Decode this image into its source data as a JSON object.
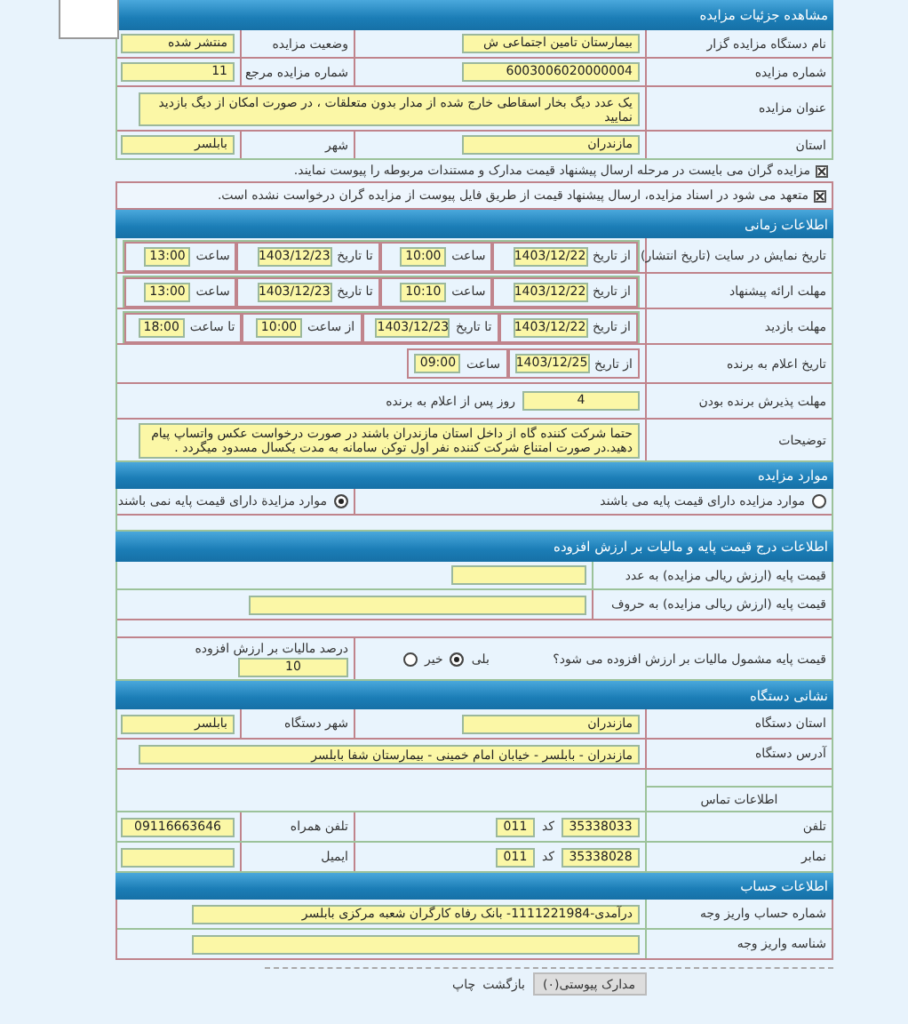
{
  "header": "مشاهده جزئیات مزایده",
  "general": [
    {
      "kind": "pair",
      "label": "نام دستگاه مزایده گزار",
      "value": "بیمارستان تامین اجتماعی ش",
      "side_label": "وضعیت مزایده",
      "side_value": "منتشر شده"
    },
    {
      "kind": "pair",
      "label": "شماره مزایده",
      "value": "6003006020000004",
      "side_label": "شماره مزایده مرجع",
      "side_value": "11"
    },
    {
      "kind": "wide",
      "label": "عنوان مزایده",
      "value": "یک عدد دیگ بخار اسقاطی خارج شده از مدار بدون متعلقات ، در صورت امکان از دیگ بازدید نمایید"
    },
    {
      "kind": "pair",
      "label": "استان",
      "value": "مازندران",
      "side_label": "شهر",
      "side_value": "بابلسر"
    }
  ],
  "notices": [
    {
      "kind": "half",
      "checked": true,
      "text": "مزایده گران می بایست در مرحله ارسال پیشنهاد قیمت مدارک و مستندات مربوطه را پیوست نمایند."
    },
    {
      "kind": "full",
      "checked": true,
      "text": "متعهد می شود در اسناد مزایده، ارسال پیشنهاد قیمت از طریق فایل پیوست از مزایده گران درخواست نشده است."
    }
  ],
  "timing": {
    "title": "اطلاعات زمانی",
    "rows": [
      {
        "kind": "range",
        "label": "تاریخ نمایش در سایت (تاریخ انتشار)",
        "parts": [
          {
            "label": "از تاریخ",
            "value": "1403/12/22"
          },
          {
            "label": "ساعت",
            "value": "10:00"
          },
          {
            "label": "تا تاریخ",
            "value": "1403/12/23"
          },
          {
            "label": "ساعت",
            "value": "13:00"
          }
        ]
      },
      {
        "kind": "range",
        "label": "مهلت ارائه پیشنهاد",
        "parts": [
          {
            "label": "از تاریخ",
            "value": "1403/12/22"
          },
          {
            "label": "ساعت",
            "value": "10:10"
          },
          {
            "label": "تا تاریخ",
            "value": "1403/12/23"
          },
          {
            "label": "ساعت",
            "value": "13:00"
          }
        ]
      },
      {
        "kind": "range",
        "label": "مهلت بازدید",
        "parts": [
          {
            "label": "از تاریخ",
            "value": "1403/12/22"
          },
          {
            "label": "تا تاریخ",
            "value": "1403/12/23"
          },
          {
            "label": "از ساعت",
            "value": "10:00"
          },
          {
            "label": "تا ساعت",
            "value": "18:00"
          }
        ]
      },
      {
        "kind": "single",
        "label": "تاریخ اعلام به برنده",
        "parts": [
          {
            "label": "از تاریخ",
            "value": "1403/12/25"
          },
          {
            "label": "ساعت",
            "value": "09:00"
          }
        ]
      }
    ],
    "acceptance": {
      "label": "مهلت پذیرش برنده بودن",
      "value": "4",
      "suffix": "روز پس از اعلام به برنده"
    },
    "description": {
      "label": "توضیحات",
      "value": "حتما شرکت کننده گاه از داخل استان مازندران باشند در صورت درخواست عکس واتساپ پیام دهید.در صورت امتناع شرکت کننده نفر اول توکن سامانه به مدت یکسال مسدود میگردد ."
    }
  },
  "items": {
    "title": "موارد مزایده",
    "options": [
      {
        "label": "موارد مزایده دارای قیمت پایه می باشند",
        "selected": false
      },
      {
        "label": "موارد مزایدة دارای قیمت پایه نمی باشند",
        "selected": true
      }
    ]
  },
  "pricing": {
    "title": "اطلاعات درج قیمت پایه و مالیات بر ارزش افزوده",
    "rows": [
      {
        "label": "قیمت پایه (ارزش ریالی مزایده) به عدد",
        "kind": "short"
      },
      {
        "label": "قیمت پایه (ارزش ریالی مزایده) به حروف",
        "kind": "long"
      }
    ],
    "vat": {
      "question": "قیمت پایه مشمول مالیات بر ارزش افزوده می شود؟",
      "options": [
        {
          "label": "بلی",
          "selected": true
        },
        {
          "label": "خیر",
          "selected": false
        }
      ],
      "rate_label": "درصد مالیات بر ارزش افزوده",
      "rate": "10"
    }
  },
  "address": {
    "title": "نشانی دستگاه",
    "rows": [
      {
        "kind": "pair",
        "label": "استان دستگاه",
        "value": "مازندران",
        "side_label": "شهر دستگاه",
        "side_value": "بابلسر"
      },
      {
        "kind": "wide",
        "label": "آدرس دستگاه",
        "value": "مازندران - بابلسر - خیابان امام خمینی - بیمارستان شفا بابلسر"
      }
    ],
    "contact_title": "اطلاعات تماس",
    "phones": [
      {
        "label": "تلفن",
        "value": "35338033",
        "code_label": "کد",
        "code": "011",
        "side_label": "تلفن همراه",
        "side_value": "09116663646"
      },
      {
        "label": "نمابر",
        "value": "35338028",
        "code_label": "کد",
        "code": "011",
        "side_label": "ایمیل"
      }
    ]
  },
  "account": {
    "title": "اطلاعات حساب",
    "rows": [
      {
        "label": "شماره حساب واریز وجه",
        "value": "درآمدی-1111221984- بانک رفاه کارگران شعبه مرکزی بابلسر"
      },
      {
        "label": "شناسه واریز وجه"
      }
    ]
  },
  "footer": {
    "button": "مدارک پیوستی(۰)",
    "links": [
      "بازگشت",
      "چاپ"
    ]
  }
}
